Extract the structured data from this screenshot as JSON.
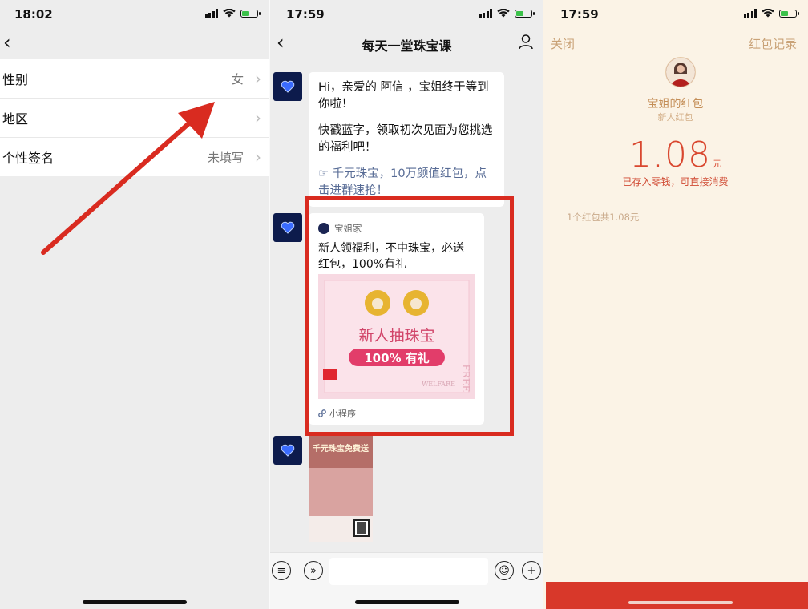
{
  "panel1": {
    "time": "18:02",
    "rows": [
      {
        "label": "性别",
        "value": "女"
      },
      {
        "label": "地区",
        "value": ""
      },
      {
        "label": "个性签名",
        "value": "未填写"
      }
    ]
  },
  "panel2": {
    "time": "17:59",
    "title": "每天一堂珠宝课",
    "message": {
      "line1": "Hi，亲爱的 阿信 ，宝姐终于等到你啦！",
      "line2": "快戳蓝字，领取初次见面为您挑选的福利吧！",
      "link": "☞ 千元珠宝，10万颜值红包，点击进群速抢！"
    },
    "card": {
      "source": "宝姐家",
      "title": "新人领福利，不中珠宝，必送红包，100%有礼",
      "image_text_main": "新人抽珠宝",
      "image_text_badge": "100% 有礼",
      "image_side_text": "FREE",
      "image_welfare_text": "WELFARE",
      "footer": "小程序"
    },
    "poster_title": "千元珠宝免费送"
  },
  "panel3": {
    "time": "17:59",
    "close_label": "关闭",
    "records_label": "红包记录",
    "sender": "宝姐的红包",
    "subtitle": "新人红包",
    "amount": "1.08",
    "unit": "元",
    "note": "已存入零钱，可直接消费",
    "summary": "1个红包共1.08元"
  },
  "colors": {
    "highlight": "#d92b20",
    "arrow": "#d92b20",
    "link": "#576b95",
    "amount": "#d9472f",
    "gold": "#c9a277"
  }
}
